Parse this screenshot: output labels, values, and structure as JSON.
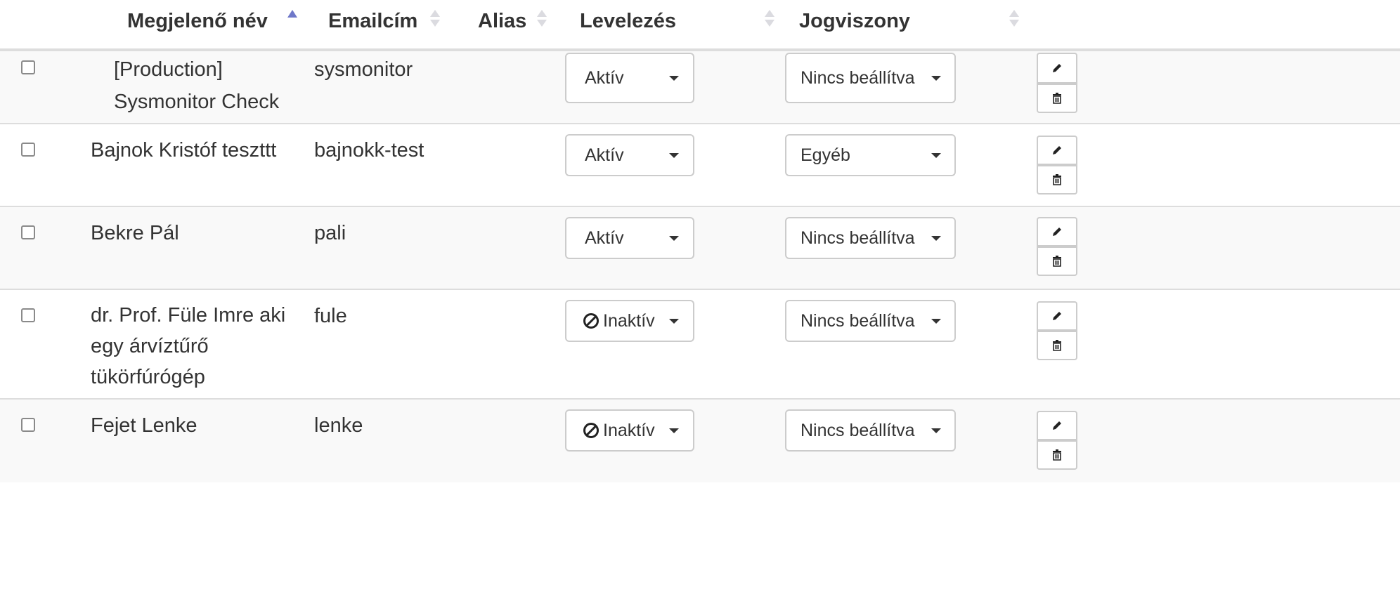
{
  "table": {
    "columns": {
      "name": "Megjelenő név",
      "email": "Emailcím",
      "alias": "Alias",
      "mailing": "Levelezés",
      "employment": "Jogviszony"
    },
    "sort": {
      "column": "name",
      "direction": "asc"
    },
    "rows": [
      {
        "name_lines": [
          "[Production]",
          "Sysmonitor Check"
        ],
        "email": "sysmonitor",
        "alias": "",
        "mailing": "Aktív",
        "mailing_icon": "",
        "employment": "Nincs beállítva"
      },
      {
        "name_lines": [
          "Bajnok Kristóf teszttt"
        ],
        "email": "bajnokk-test",
        "alias": "",
        "mailing": "Aktív",
        "mailing_icon": "",
        "employment": "Egyéb"
      },
      {
        "name_lines": [
          "Bekre Pál"
        ],
        "email": "pali",
        "alias": "",
        "mailing": "Aktív",
        "mailing_icon": "",
        "employment": "Nincs beállítva"
      },
      {
        "name_lines": [
          "dr. Prof. Füle Imre aki",
          "egy árvíztűrő",
          "tükörfúrógép"
        ],
        "email": "fule",
        "alias": "",
        "mailing": "Inaktív",
        "mailing_icon": "ban-icon",
        "employment": "Nincs beállítva"
      },
      {
        "name_lines": [
          "Fejet Lenke"
        ],
        "email": "lenke",
        "alias": "",
        "mailing": "Inaktív",
        "mailing_icon": "ban-icon",
        "employment": "Nincs beállítva"
      }
    ],
    "row_actions": {
      "edit_icon": "pencil-icon",
      "delete_icon": "trash-icon"
    }
  }
}
